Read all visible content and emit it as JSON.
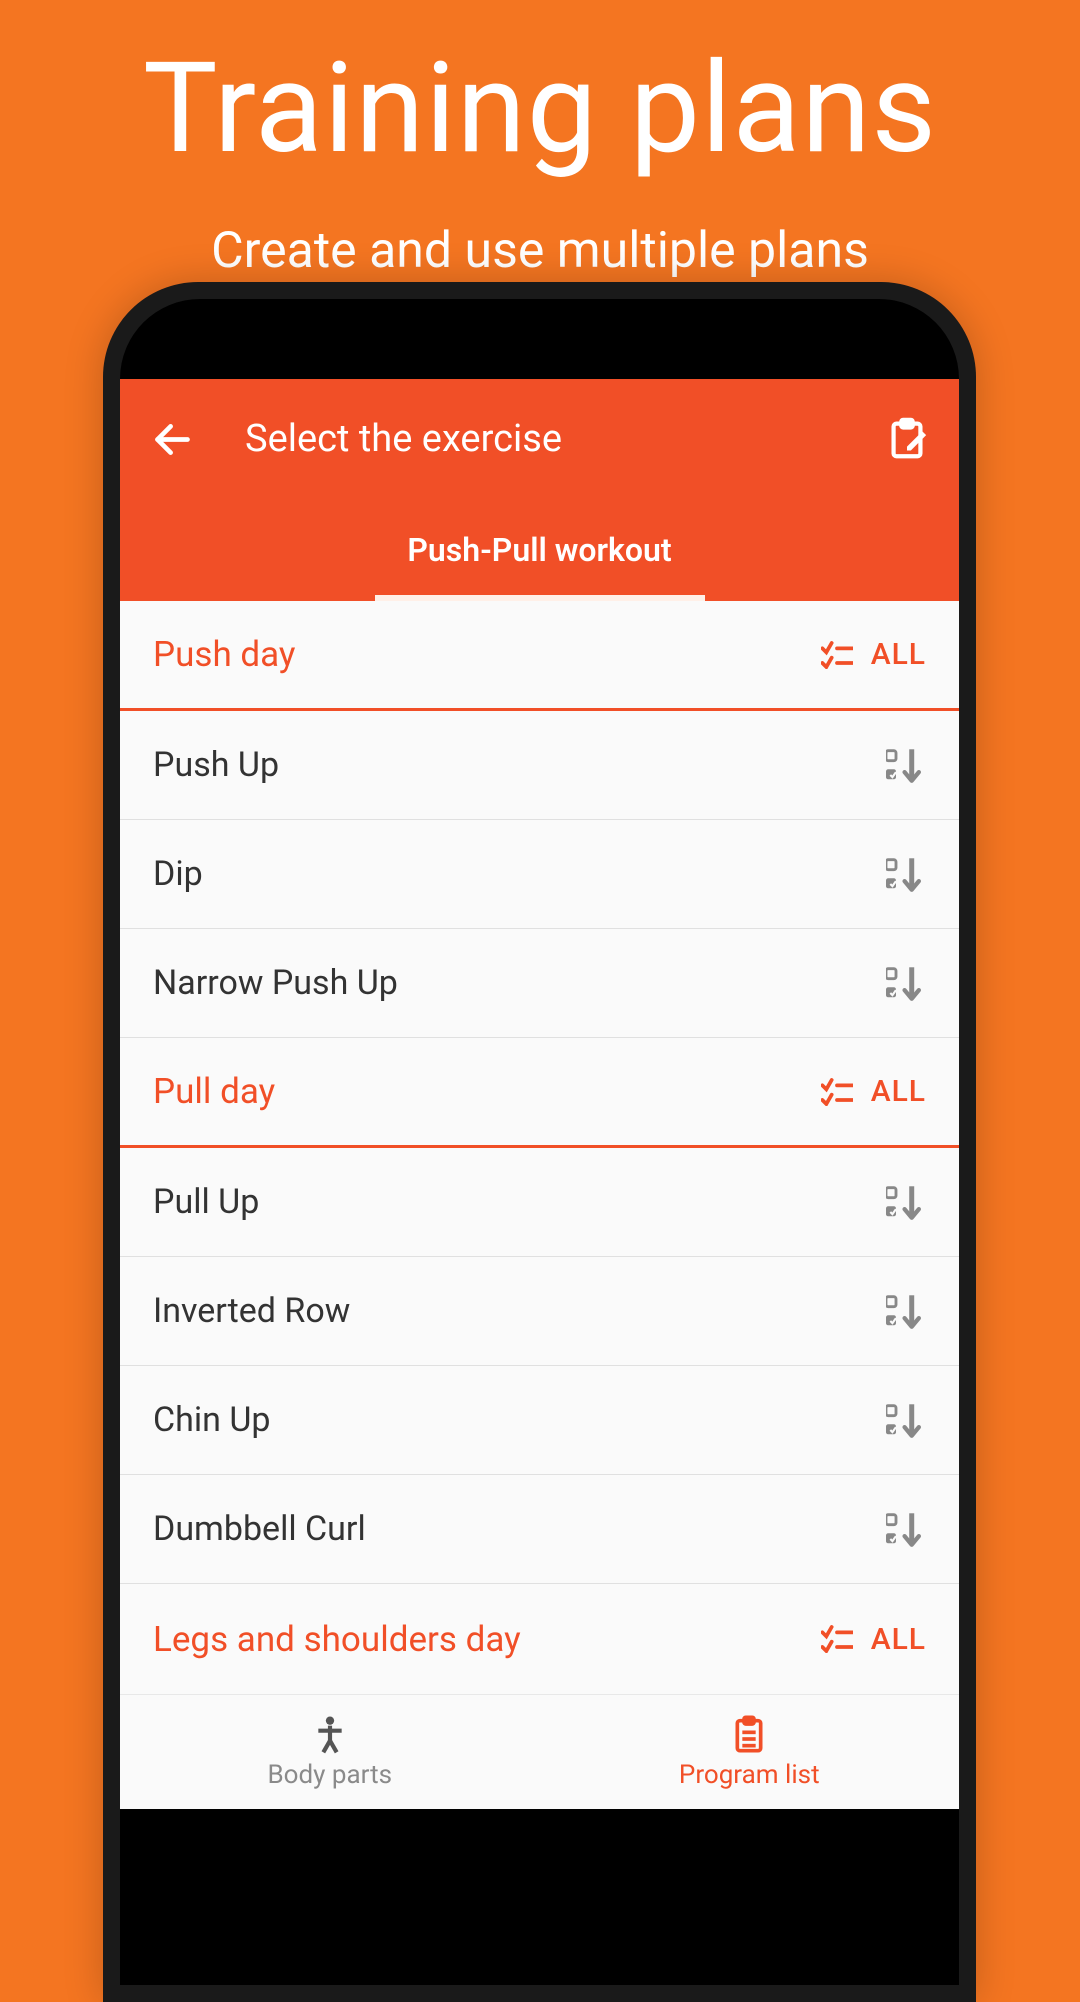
{
  "promo": {
    "title": "Training plans",
    "subtitle": "Create and use multiple plans"
  },
  "appbar": {
    "title": "Select the exercise"
  },
  "subheader": {
    "workout_name": "Push-Pull workout"
  },
  "sections": [
    {
      "title": "Push day",
      "all_label": "ALL"
    },
    {
      "title": "Pull day",
      "all_label": "ALL"
    },
    {
      "title": "Legs and shoulders day",
      "all_label": "ALL"
    }
  ],
  "exercises": {
    "push": [
      {
        "name": "Push Up"
      },
      {
        "name": "Dip"
      },
      {
        "name": "Narrow Push Up"
      }
    ],
    "pull": [
      {
        "name": "Pull Up"
      },
      {
        "name": "Inverted Row"
      },
      {
        "name": "Chin Up"
      },
      {
        "name": "Dumbbell Curl"
      }
    ]
  },
  "bottomnav": {
    "body_parts": "Body parts",
    "program_list": "Program list"
  },
  "colors": {
    "accent": "#f14f27",
    "background": "#f47521"
  }
}
